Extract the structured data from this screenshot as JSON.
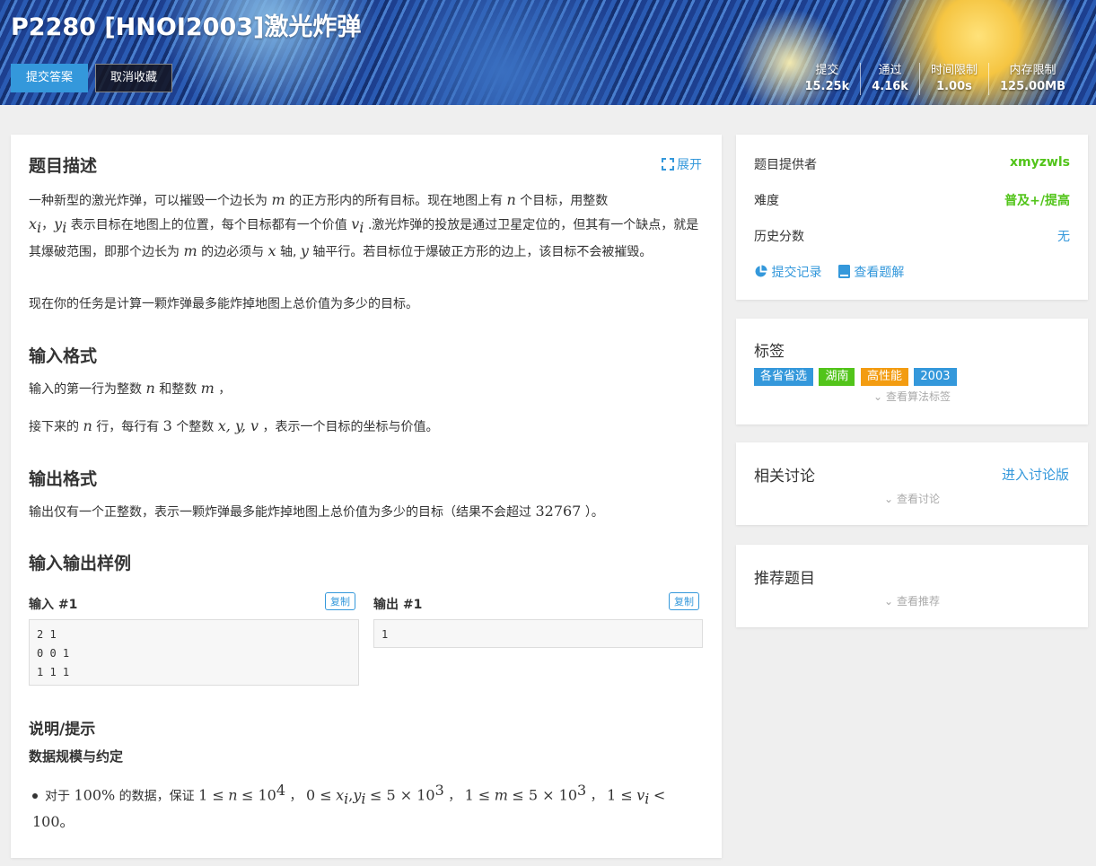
{
  "header": {
    "title": "P2280 [HNOI2003]激光炸弹",
    "submit_label": "提交答案",
    "unfavorite_label": "取消收藏",
    "stats": [
      {
        "label": "提交",
        "value": "15.25k"
      },
      {
        "label": "通过",
        "value": "4.16k"
      },
      {
        "label": "时间限制",
        "value": "1.00s"
      },
      {
        "label": "内存限制",
        "value": "125.00MB"
      }
    ]
  },
  "problem": {
    "desc_title": "题目描述",
    "expand_label": "展开",
    "desc_p1_a": "一种新型的激光炸弹，可以摧毁一个边长为",
    "var_m": "m",
    "desc_p1_b": "的正方形内的所有目标。现在地图上有",
    "var_n": "n",
    "desc_p1_c": "个目标，用整数",
    "var_x": "x",
    "sub_i": "i",
    "sep_comma": "，",
    "var_y": "y",
    "desc_p1_d": "表示目标在地图上的位置，每个目标都有一个价值",
    "var_v": "v",
    "desc_p1_e": ".激光炸弹的投放是通过卫星定位的，但其有一个缺点，就是其爆破范围，即那个边长为",
    "desc_p1_f": "的边必须与",
    "desc_p1_g": "轴,",
    "desc_p1_h": "轴平行。若目标位于爆破正方形的边上，该目标不会被摧毁。",
    "desc_p2": "现在你的任务是计算一颗炸弹最多能炸掉地图上总价值为多少的目标。",
    "input_title": "输入格式",
    "input_p1_a": "输入的第一行为整数",
    "input_p1_b": "和整数",
    "input_p1_c": "，",
    "input_p2_a": "接下来的",
    "input_p2_b": "行，每行有",
    "num_3": "3",
    "input_p2_c": "个整数",
    "xyv": "x, y, v",
    "input_p2_d": "，表示一个目标的坐标与价值。",
    "output_title": "输出格式",
    "output_p_a": "输出仅有一个正整数，表示一颗炸弹最多能炸掉地图上总价值为多少的目标（结果不会超过",
    "num_32767": "32767",
    "output_p_b": "）。",
    "samples_title": "输入输出样例",
    "input_sample_title": "输入 #1",
    "output_sample_title": "输出 #1",
    "copy_label": "复制",
    "input_sample_lines": [
      "2 1",
      "0 0 1",
      "1 1 1"
    ],
    "output_sample_lines": [
      "1"
    ],
    "hint_title": "说明/提示",
    "hint_subtitle": "数据规模与约定",
    "hint_a": "对于",
    "hint_100pct": "100%",
    "hint_b": "的数据，保证",
    "hint_c1": "1 ≤",
    "hint_c2": "≤ 10",
    "exp_4": "4",
    "hint_d1": "0 ≤",
    "hint_d2": "≤ 5 × 10",
    "exp_3": "3",
    "hint_e1": "1 ≤",
    "hint_f1": "1 ≤",
    "hint_f2": "<",
    "hint_last": "100。"
  },
  "sidebar": {
    "provider_label": "题目提供者",
    "provider_value": "xmyzwls",
    "difficulty_label": "难度",
    "difficulty_value": "普及+/提高",
    "history_label": "历史分数",
    "history_value": "无",
    "records_label": "提交记录",
    "solutions_label": "查看题解",
    "tags_title": "标签",
    "tags": [
      {
        "label": "各省省选",
        "color": "#3498db"
      },
      {
        "label": "湖南",
        "color": "#52c41a"
      },
      {
        "label": "高性能",
        "color": "#f39c11"
      },
      {
        "label": "2003",
        "color": "#3498db"
      }
    ],
    "show_algo_tags": "查看算法标签",
    "discuss_title": "相关讨论",
    "discuss_link": "进入讨论版",
    "show_discuss": "查看讨论",
    "recommend_title": "推荐题目",
    "show_recommend": "查看推荐"
  },
  "colors": {
    "accent": "#3498db",
    "green": "#52c41a",
    "orange": "#f39c11"
  }
}
